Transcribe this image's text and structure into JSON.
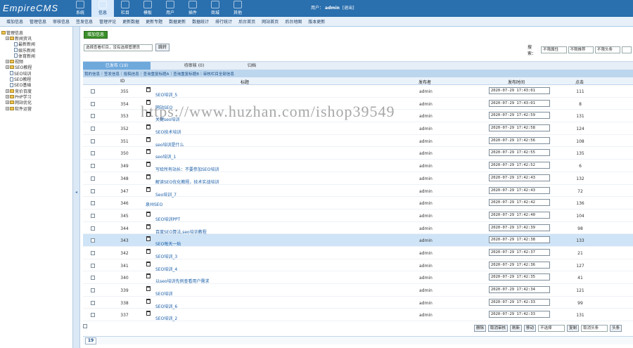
{
  "app": {
    "logo": "EmpireCMS"
  },
  "topnav": [
    {
      "label": "系统"
    },
    {
      "label": "信息"
    },
    {
      "label": "栏目"
    },
    {
      "label": "模板"
    },
    {
      "label": "用户"
    },
    {
      "label": "插件"
    },
    {
      "label": "商城"
    },
    {
      "label": "其他"
    }
  ],
  "user": {
    "prefix": "用户：",
    "name": "admin",
    "logout": "[退出]"
  },
  "submenu": [
    "增加信息",
    "管理信息",
    "审核信息",
    "签发信息",
    "管理评论",
    "更新数据",
    "更新专题",
    "数据更新",
    "数据统计",
    "排行统计",
    "后台首页",
    "网站首页",
    "后台地图",
    "版本更新"
  ],
  "sidebar": [
    {
      "label": "管理信息",
      "indent": 0,
      "kind": "root"
    },
    {
      "label": "新闻资讯",
      "indent": 1,
      "kind": "fold"
    },
    {
      "label": "最新新闻",
      "indent": 3,
      "kind": "page"
    },
    {
      "label": "娱乐新闻",
      "indent": 3,
      "kind": "page"
    },
    {
      "label": "体育新闻",
      "indent": 3,
      "kind": "page"
    },
    {
      "label": "视频",
      "indent": 1,
      "kind": "fold"
    },
    {
      "label": "SEO教程",
      "indent": 1,
      "kind": "fold"
    },
    {
      "label": "SEO培训",
      "indent": 2,
      "kind": "page"
    },
    {
      "label": "SEO教程",
      "indent": 2,
      "kind": "page"
    },
    {
      "label": "SEO基础",
      "indent": 2,
      "kind": "page"
    },
    {
      "label": "竞价百度",
      "indent": 1,
      "kind": "fold"
    },
    {
      "label": "PHP学习",
      "indent": 1,
      "kind": "fold"
    },
    {
      "label": "网站优化",
      "indent": 1,
      "kind": "fold"
    },
    {
      "label": "软件运营",
      "indent": 1,
      "kind": "fold"
    }
  ],
  "main": {
    "add_button": "增加信息",
    "column_select": "选择查看栏目，没有选择管理员",
    "jump_button": "跳转",
    "search_label": "搜索：",
    "search_selects": [
      "不限属性",
      "不限推荐",
      "不限头条"
    ]
  },
  "tabs": [
    {
      "label": "已发布 (19)",
      "active": true
    },
    {
      "label": "待审核 (0)",
      "active": false
    },
    {
      "label": "归档",
      "active": false
    }
  ],
  "actions": [
    "我的信息",
    "签发信息",
    "投稿信息",
    "查询重复标题A",
    "查询重复标题B",
    "审核栏目全部信息"
  ],
  "columns": {
    "id": "ID",
    "title": "标题",
    "author": "发布者",
    "time": "发布时间",
    "clicks": "点击"
  },
  "rows": [
    {
      "id": "355",
      "title": "SEO培训_5",
      "author": "admin",
      "time": "2020-07-29 17:43:01",
      "clicks": "111",
      "icon": true
    },
    {
      "id": "354",
      "title": "网站SEO",
      "author": "admin",
      "time": "2020-07-29 17:43:01",
      "clicks": "8",
      "icon": true
    },
    {
      "id": "353",
      "title": "关键seo培训",
      "author": "admin",
      "time": "2020-07-29 17:42:59",
      "clicks": "131",
      "icon": true
    },
    {
      "id": "352",
      "title": "SEO技术培训",
      "author": "admin",
      "time": "2020-07-29 17:42:58",
      "clicks": "124",
      "icon": true
    },
    {
      "id": "351",
      "title": "seo培训是什么",
      "author": "admin",
      "time": "2020-07-29 17:42:56",
      "clicks": "108",
      "icon": true
    },
    {
      "id": "350",
      "title": "seo培训_1",
      "author": "admin",
      "time": "2020-07-29 17:42:55",
      "clicks": "135",
      "icon": true
    },
    {
      "id": "349",
      "title": "写给所有站长：不要参加SEO培训",
      "author": "admin",
      "time": "2020-07-29 17:42:52",
      "clicks": "6",
      "icon": true
    },
    {
      "id": "348",
      "title": "解读SEO优化教程，技术实战培训",
      "author": "admin",
      "time": "2020-07-29 17:42:43",
      "clicks": "132",
      "icon": true
    },
    {
      "id": "347",
      "title": "Seo培训_7",
      "author": "admin",
      "time": "2020-07-29 17:42:43",
      "clicks": "72",
      "icon": true
    },
    {
      "id": "346",
      "title": "泉州SEO",
      "author": "admin",
      "time": "2020-07-29 17:42:42",
      "clicks": "136",
      "icon": false
    },
    {
      "id": "345",
      "title": "SEO培训PPT",
      "author": "admin",
      "time": "2020-07-29 17:42:40",
      "clicks": "104",
      "icon": true
    },
    {
      "id": "344",
      "title": "百度SEO算法,seo培训教程",
      "author": "admin",
      "time": "2020-07-29 17:42:39",
      "clicks": "98",
      "icon": true
    },
    {
      "id": "343",
      "title": "SEO每天一贴",
      "author": "admin",
      "time": "2020-07-29 17:42:38",
      "clicks": "133",
      "icon": true,
      "highlight": true
    },
    {
      "id": "342",
      "title": "SEO培训_3",
      "author": "admin",
      "time": "2020-07-29 17:42:37",
      "clicks": "21",
      "icon": true
    },
    {
      "id": "341",
      "title": "SEO培训_4",
      "author": "admin",
      "time": "2020-07-29 17:42:36",
      "clicks": "127",
      "icon": true
    },
    {
      "id": "340",
      "title": "以seo培训先例查看用户需求",
      "author": "admin",
      "time": "2020-07-29 17:42:35",
      "clicks": "41",
      "icon": true
    },
    {
      "id": "339",
      "title": "SEO培训",
      "author": "admin",
      "time": "2020-07-29 17:42:34",
      "clicks": "121",
      "icon": true
    },
    {
      "id": "338",
      "title": "SEO培训_6",
      "author": "admin",
      "time": "2020-07-29 17:42:33",
      "clicks": "99",
      "icon": true
    },
    {
      "id": "337",
      "title": "SEO培训_2",
      "author": "admin",
      "time": "2020-07-29 17:42:33",
      "clicks": "131",
      "icon": true
    }
  ],
  "bottom": {
    "delete": "删除",
    "unaudit": "取消审核",
    "refresh": "刷新",
    "move": "移动",
    "move_select": "不选择",
    "copy": "复制",
    "top_select": "取消头条",
    "headline": "头条"
  },
  "pager": {
    "count": "19"
  },
  "watermark": "https://www.huzhan.com/ishop39549"
}
